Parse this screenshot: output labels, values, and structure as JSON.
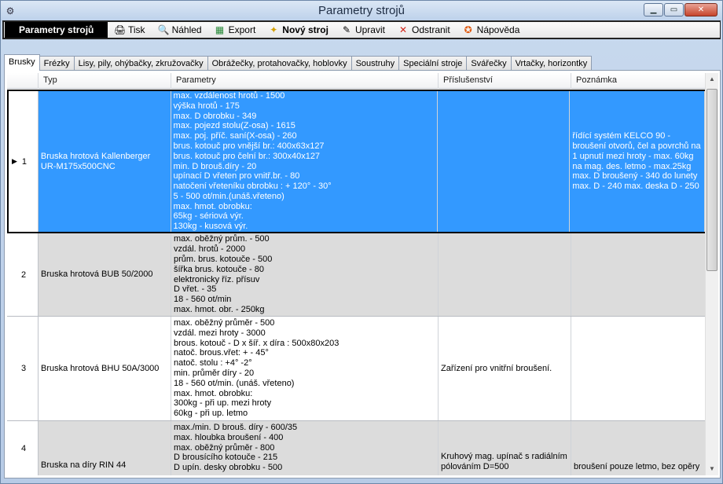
{
  "window": {
    "title": "Parametry strojů",
    "icon": "machine-icon"
  },
  "toolbar": {
    "title": "Parametry strojů",
    "buttons": [
      {
        "label": "Tisk",
        "icon": "printer-icon",
        "glyph": "🖨"
      },
      {
        "label": "Náhled",
        "icon": "preview-icon",
        "glyph": "🔍"
      },
      {
        "label": "Export",
        "icon": "export-icon",
        "glyph": "📊"
      },
      {
        "label": "Nový stroj",
        "icon": "new-icon",
        "glyph": "✦"
      },
      {
        "label": "Upravit",
        "icon": "pencil-icon",
        "glyph": "✎"
      },
      {
        "label": "Odstranit",
        "icon": "delete-icon",
        "glyph": "✕"
      },
      {
        "label": "Nápověda",
        "icon": "help-icon",
        "glyph": "✪"
      }
    ]
  },
  "tabs": [
    "Brusky",
    "Frézky",
    "Lisy, pily, ohýbačky, zkružovačky",
    "Obrážečky, protahovačky, hoblovky",
    "Soustruhy",
    "Speciální stroje",
    "Svářečky",
    "Vrtačky, horizontky"
  ],
  "active_tab": "Brusky",
  "grid": {
    "columns": [
      "Typ",
      "Parametry",
      "Příslušenství",
      "Poznámka"
    ],
    "rows": [
      {
        "num": "1",
        "typ": [
          "Bruska hrotová Kallenberger",
          "UR-M175x500CNC"
        ],
        "parametry": [
          "max. vzdálenost hrotů - 1500",
          "výška hrotů - 175",
          "max. D obrobku - 349",
          "max. pojezd stolu(Z-osa) - 1615",
          "max. poj. příč. saní(X-osa) - 260",
          "brus. kotouč pro vnější br.:  400x63x127",
          "brus. kotouč pro čelní br.:  300x40x127",
          "min. D brouš.díry - 20",
          "upínací D vřeten pro vnitř.br. - 80",
          "natočení vřeteníku obrobku : + 120° - 30°",
          "5 - 500 ot/min.(unáš.vřeteno)",
          "max. hmot. obrobku:",
          "65kg - sériová výr.",
          "130kg - kusová výr."
        ],
        "prislusenstvi": [],
        "poznamka": [
          "řídící systém KELCO 90 -",
          "broušení otvorů, čel a povrchů na",
          "1 upnutí mezi hroty - max. 60kg",
          "na mag. des. letmo - max.25kg",
          "max. D broušený - 340 do lunety",
          "max. D - 240 max. deska D - 250"
        ]
      },
      {
        "num": "2",
        "typ": [
          "Bruska hrotová BUB 50/2000"
        ],
        "parametry": [
          "max. oběžný prům. - 500",
          "vzdál. hrotů - 2000",
          "prům. brus. kotouče - 500",
          "šířka brus. kotouče - 80",
          "elektronicky říz. přísuv",
          "D vřet. - 35",
          "18 - 560 ot/min",
          "max. hmot. obr. - 250kg"
        ],
        "prislusenstvi": [],
        "poznamka": []
      },
      {
        "num": "3",
        "typ": [
          "Bruska hrotová BHU 50A/3000"
        ],
        "parametry": [
          "max. oběžný průměr - 500",
          "vzdál. mezi hroty - 3000",
          "brous. kotouč - D x šíř. x díra :  500x80x203",
          "natoč. brous.vřet: + - 45°",
          "natoč. stolu : +4° -2°",
          "min. průměr díry - 20",
          "18 - 560 ot/min. (unáš. vřeteno)",
          "max. hmot. obrobku:",
          "300kg - při up. mezi hroty",
          "60kg - při up. letmo"
        ],
        "prislusenstvi": [
          "Zařízení pro vnitřní broušení."
        ],
        "poznamka": []
      },
      {
        "num": "4",
        "typ": [
          "Bruska na díry RIN 44"
        ],
        "parametry": [
          "max./min. D brouš. díry - 600/35",
          "max. hloubka broušení - 400",
          "max. oběžný průměr - 800",
          "D brousícího kotouče - 215",
          "D upín. desky obrobku - 500"
        ],
        "prislusenstvi": [
          "Kruhový mag. upínač s radiálním",
          "pólováním D=500"
        ],
        "poznamka": [
          "broušení pouze letmo, bez opěry"
        ]
      }
    ]
  },
  "colors": {
    "selection": "#3399ff",
    "alt_row": "#dcdcdc"
  }
}
